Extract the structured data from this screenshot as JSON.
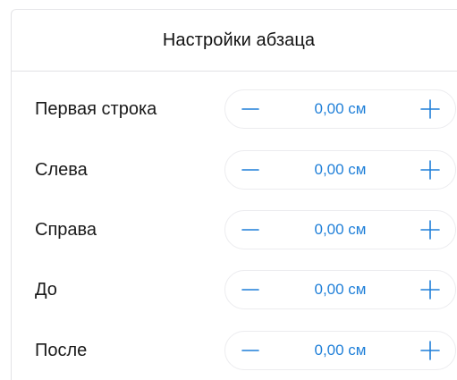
{
  "panel": {
    "title": "Настройки абзаца"
  },
  "rows": [
    {
      "label": "Первая строка",
      "value": "0,00 см",
      "minus_icon": "minus-icon",
      "plus_icon": "plus-icon"
    },
    {
      "label": "Слева",
      "value": "0,00 см",
      "minus_icon": "minus-icon",
      "plus_icon": "plus-icon"
    },
    {
      "label": "Справа",
      "value": "0,00 см",
      "minus_icon": "minus-icon",
      "plus_icon": "plus-icon"
    },
    {
      "label": "До",
      "value": "0,00 см",
      "minus_icon": "minus-icon",
      "plus_icon": "plus-icon"
    },
    {
      "label": "После",
      "value": "0,00 см",
      "minus_icon": "minus-icon",
      "plus_icon": "plus-icon"
    }
  ],
  "colors": {
    "accent": "#1f7fd8",
    "text": "#1a1a1a",
    "divider": "#e1e1e4",
    "stepper_border": "#ececef"
  }
}
